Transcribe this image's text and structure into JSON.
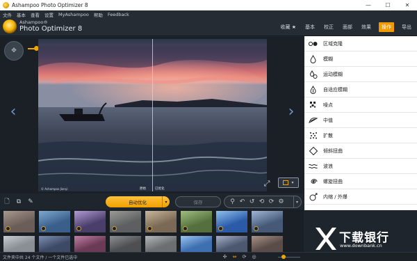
{
  "window": {
    "title": "Ashampoo Photo Optimizer 8",
    "buttons": [
      "—",
      "☐",
      "✕"
    ]
  },
  "menu": [
    "文件",
    "基本",
    "查看",
    "设置",
    "MyAshampoo",
    "帮助",
    "Feedback"
  ],
  "brand": {
    "sub": "Ashampoo®",
    "main": "Photo Optimizer 8"
  },
  "nav": {
    "tabs": [
      "收藏 ★",
      "基本",
      "校正",
      "面部",
      "效果",
      "操作",
      "导出"
    ],
    "active": "操作"
  },
  "viewer": {
    "labels": [
      "原始",
      "已优化"
    ],
    "copyright": "© Ashampoo Jianyi",
    "zoom_level": 0.2,
    "compare_split": 0.5
  },
  "tools": [
    {
      "label": "区域克隆",
      "icon": "clone-area-icon"
    },
    {
      "label": "模糊",
      "icon": "blur-drop-icon"
    },
    {
      "label": "运动模糊",
      "icon": "motion-blur-icon"
    },
    {
      "label": "自适应模糊",
      "icon": "adaptive-blur-icon"
    },
    {
      "label": "噪点",
      "icon": "noise-icon"
    },
    {
      "label": "中值",
      "icon": "median-icon"
    },
    {
      "label": "扩散",
      "icon": "diffuse-icon"
    },
    {
      "label": "倾斜扭曲",
      "icon": "skew-distort-icon"
    },
    {
      "label": "波浪",
      "icon": "wave-icon"
    },
    {
      "label": "螺旋扭曲",
      "icon": "swirl-icon"
    },
    {
      "label": "内缩 / 外爆",
      "icon": "pinch-explode-icon"
    }
  ],
  "toolbar": {
    "auto_label": "自动优化",
    "save_label": "保存"
  },
  "thumbnails": {
    "count_row1": 8,
    "count_row2": 8
  },
  "status": {
    "text": "文件夹中共 24 个文件 / 一个文件已选中",
    "thumb_size": 0.25
  },
  "watermark": {
    "title": "下载银行",
    "url": "www.downbank.cn"
  },
  "colors": {
    "accent": "#f2a600",
    "panel_bg": "#1f252d",
    "tool_panel_bg": "#ffffff",
    "nav_arrow": "#6e98c8"
  }
}
